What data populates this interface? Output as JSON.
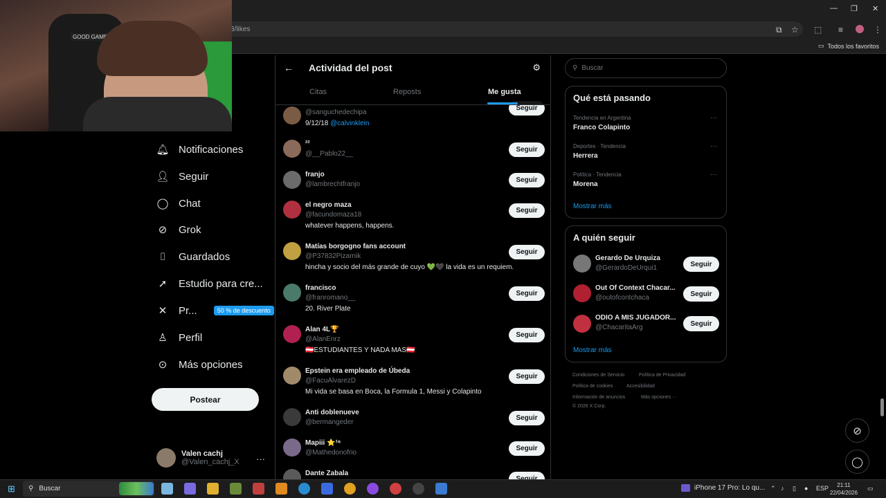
{
  "browser": {
    "url": "3/likes",
    "bookmarks_all": "Todos los favoritos"
  },
  "webcam": {
    "chair_label": "GOOD GAME"
  },
  "nav": {
    "items": [
      {
        "label": "Notificaciones",
        "icon": "bell-icon"
      },
      {
        "label": "Seguir",
        "icon": "person-add-icon"
      },
      {
        "label": "Chat",
        "icon": "chat-icon"
      },
      {
        "label": "Grok",
        "icon": "grok-icon"
      },
      {
        "label": "Guardados",
        "icon": "bookmark-icon"
      },
      {
        "label": "Estudio para cre...",
        "icon": "rocket-icon"
      },
      {
        "label": "Pr...",
        "icon": "x-logo-icon"
      },
      {
        "label": "Perfil",
        "icon": "person-icon"
      },
      {
        "label": "Más opciones",
        "icon": "more-circle-icon"
      }
    ],
    "premium_badge": "50 % de descuento",
    "post_button": "Postear",
    "account": {
      "name": "Valen cachj",
      "handle": "@Valen_cachj_X"
    }
  },
  "center": {
    "title": "Actividad del post",
    "tabs": [
      "Citas",
      "Reposts",
      "Me gusta"
    ],
    "active_tab": "Me gusta",
    "follow_label": "Seguir",
    "rows": [
      {
        "name": "",
        "handle": "@sanguchedechipa",
        "bio": "9/12/18 ",
        "mention": "@calvinklein",
        "avatar_color": "#7a5c44"
      },
      {
        "name": "²²",
        "handle": "@__Pablo22__",
        "bio": "",
        "avatar_color": "#8a6a5a"
      },
      {
        "name": "franjo",
        "handle": "@lambrechtfranjo",
        "bio": "",
        "avatar_color": "#6b6b6b"
      },
      {
        "name": "el negro maza",
        "handle": "@facundomaza18",
        "bio": "whatever happens, happens.",
        "avatar_color": "#b03040"
      },
      {
        "name": "Matías borgogno fans account",
        "handle": "@P37832Pizarnik",
        "bio": "hincha y socio del más grande de cuyo 💚🖤 la vida es un requiem.",
        "avatar_color": "#c0a040"
      },
      {
        "name": "francisco",
        "handle": "@franromano__",
        "bio": "20. River Plate",
        "avatar_color": "#4a7a6a"
      },
      {
        "name": "Alan 4L🏆",
        "handle": "@AlanEnrz",
        "bio": "🇦🇹ESTUDIANTES Y NADA MAS🇦🇹",
        "avatar_color": "#b02050"
      },
      {
        "name": "Epstein era empleado de Úbeda",
        "handle": "@FacuAlvarezD",
        "bio": "Mi vida se basa en Boca, la Formula 1, Messi y Colapinto",
        "avatar_color": "#a08a6a"
      },
      {
        "name": "Anti doblenueve",
        "handle": "@bermangeder",
        "bio": "",
        "avatar_color": "#3a3a3a"
      },
      {
        "name": "Mapiii ⭐¹⁶",
        "handle": "@Mathedonofrio",
        "bio": "",
        "avatar_color": "#7a6a8a"
      },
      {
        "name": "Dante Zabala",
        "handle": "",
        "bio": "",
        "avatar_color": "#5a5a5a"
      }
    ]
  },
  "right": {
    "search_placeholder": "Buscar",
    "trending": {
      "title": "Qué está pasando",
      "items": [
        {
          "meta": "Tendencia en Argentina",
          "name": "Franco Colapinto"
        },
        {
          "meta": "Deportes · Tendencia",
          "name": "Herrera"
        },
        {
          "meta": "Política · Tendencia",
          "name": "Morena"
        }
      ],
      "show_more": "Mostrar más"
    },
    "who_to_follow": {
      "title": "A quién seguir",
      "items": [
        {
          "name": "Gerardo De Urquiza",
          "handle": "@GerardoDeUrqui1",
          "avatar_color": "#777"
        },
        {
          "name": "Out Of Context Chacar...",
          "handle": "@outofcontchaca",
          "avatar_color": "#b02030"
        },
        {
          "name": "ODIO A MIS JUGADOR...",
          "handle": "@ChacaritaArg",
          "avatar_color": "#c03040"
        }
      ],
      "follow_label": "Seguir",
      "show_more": "Mostrar más"
    },
    "footer": [
      "Condiciones de Servicio",
      "Política de Privacidad",
      "Política de cookies",
      "Accesibilidad",
      "Información de anuncios",
      "Más opciones ···",
      "© 2026 X Corp."
    ]
  },
  "taskbar": {
    "search": "Buscar",
    "notification": "iPhone 17 Pro: Lo qu...",
    "lang": "ESP",
    "time": "21:11",
    "date": "22/04/2026"
  }
}
